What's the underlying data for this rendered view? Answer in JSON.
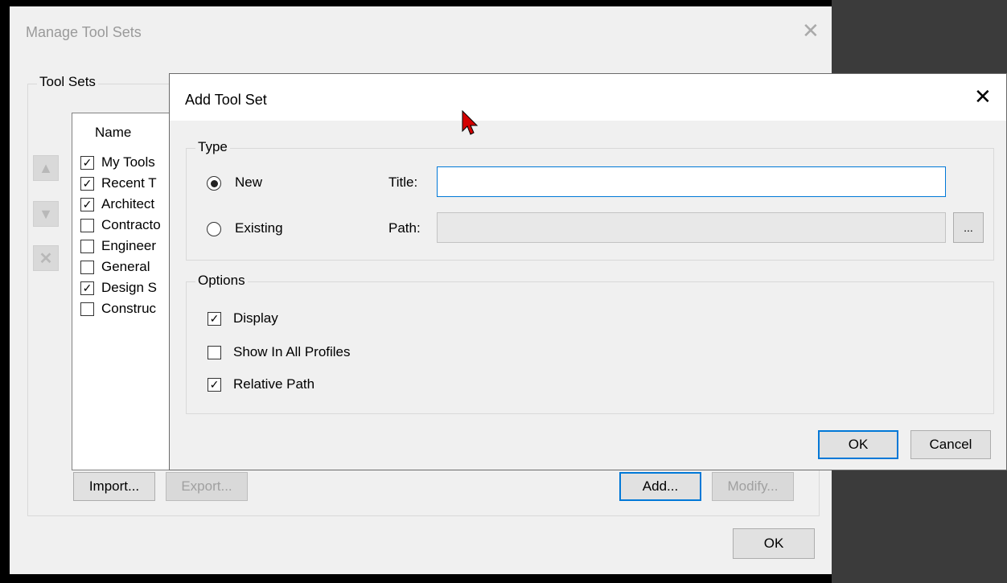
{
  "manage_dialog": {
    "title": "Manage Tool Sets",
    "group_label": "Tool Sets",
    "column_header": "Name",
    "items": [
      {
        "label": "My Tools",
        "checked": true
      },
      {
        "label": "Recent T",
        "checked": true
      },
      {
        "label": "Architect",
        "checked": true
      },
      {
        "label": "Contracto",
        "checked": false
      },
      {
        "label": "Engineer",
        "checked": false
      },
      {
        "label": "General ",
        "checked": false
      },
      {
        "label": "Design S",
        "checked": true
      },
      {
        "label": "Construc",
        "checked": false
      }
    ],
    "import_label": "Import...",
    "export_label": "Export...",
    "add_label": "Add...",
    "modify_label": "Modify...",
    "ok_label": "OK"
  },
  "add_dialog": {
    "title": "Add Tool Set",
    "type_group": "Type",
    "new_label": "New",
    "existing_label": "Existing",
    "title_label": "Title:",
    "title_value": "",
    "path_label": "Path:",
    "path_value": "",
    "browse_label": "...",
    "options_group": "Options",
    "display_label": "Display",
    "show_all_label": "Show In All Profiles",
    "relative_label": "Relative Path",
    "ok_label": "OK",
    "cancel_label": "Cancel"
  },
  "colors": {
    "accent": "#0078d7",
    "cursor": "#d40000"
  }
}
